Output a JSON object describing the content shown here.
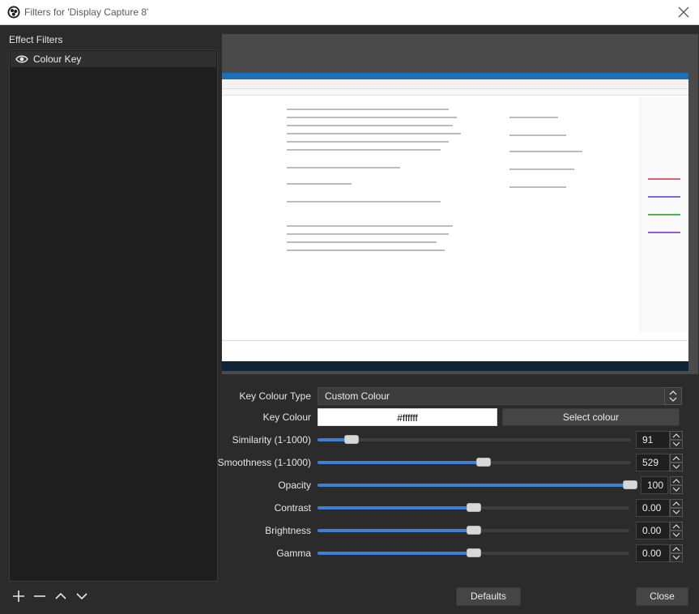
{
  "window": {
    "title": "Filters for 'Display Capture 8'"
  },
  "left": {
    "header": "Effect Filters",
    "filters": [
      {
        "label": "Colour Key",
        "icon": "eye-icon"
      }
    ]
  },
  "properties": {
    "key_colour_type": {
      "label": "Key Colour Type",
      "value": "Custom Colour"
    },
    "key_colour": {
      "label": "Key Colour",
      "value": "#ffffff",
      "select_button": "Select colour"
    },
    "sliders": [
      {
        "label": "Similarity (1-1000)",
        "value": "91",
        "fraction": 0.09
      },
      {
        "label": "Smoothness (1-1000)",
        "value": "529",
        "fraction": 0.53
      },
      {
        "label": "Opacity",
        "value": "100",
        "fraction": 1.0
      },
      {
        "label": "Contrast",
        "value": "0.00",
        "fraction": 0.5
      },
      {
        "label": "Brightness",
        "value": "0.00",
        "fraction": 0.5
      },
      {
        "label": "Gamma",
        "value": "0.00",
        "fraction": 0.5
      }
    ]
  },
  "buttons": {
    "defaults": "Defaults",
    "close": "Close"
  },
  "colors": {
    "accent": "#3a80d6",
    "panel": "#2b2b2b",
    "list": "#1e1e1e"
  }
}
